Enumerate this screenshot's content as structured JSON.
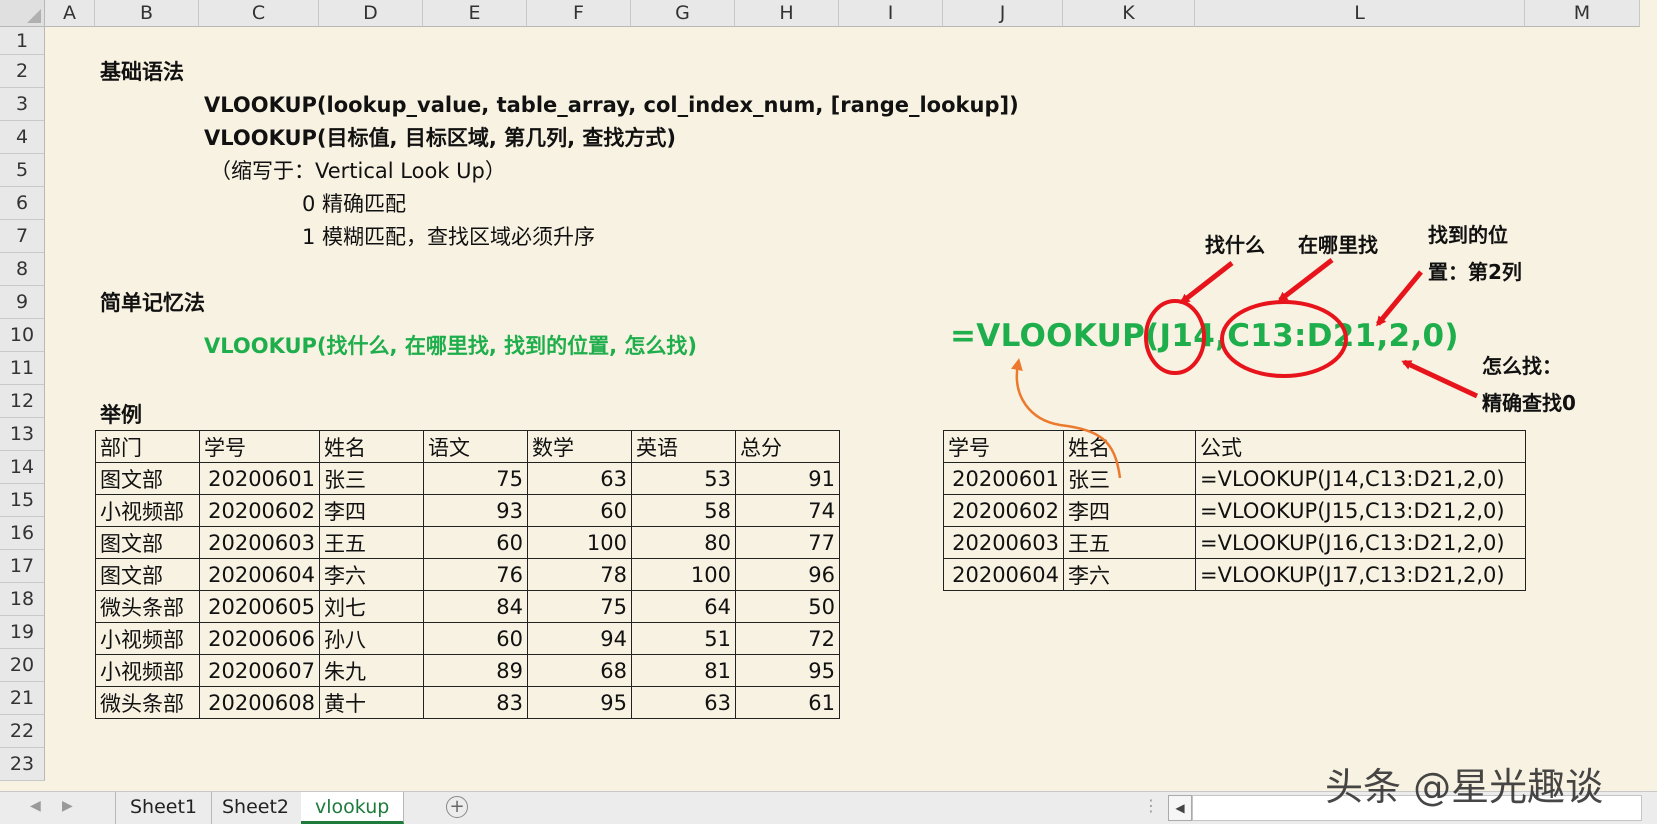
{
  "columns": [
    "A",
    "B",
    "C",
    "D",
    "E",
    "F",
    "G",
    "H",
    "I",
    "J",
    "K",
    "L",
    "M"
  ],
  "rows": [
    "1",
    "2",
    "3",
    "4",
    "5",
    "6",
    "7",
    "8",
    "9",
    "10",
    "11",
    "12",
    "13",
    "14",
    "15",
    "16",
    "17",
    "18",
    "19",
    "20",
    "21",
    "22",
    "23"
  ],
  "syntax": {
    "heading": "基础语法",
    "line_en": "VLOOKUP(lookup_value, table_array, col_index_num, [range_lookup])",
    "line_cn": "VLOOKUP(目标值, 目标区域, 第几列, 查找方式)",
    "abbrev": "（缩写于：Vertical Look Up）",
    "opt0": "0  精确匹配",
    "opt1": "1  模糊匹配，查找区域必须升序"
  },
  "memory": {
    "heading": "简单记忆法",
    "formula": "VLOOKUP(找什么, 在哪里找, 找到的位置, 怎么找)"
  },
  "example": {
    "heading": "举例",
    "headers": [
      "部门",
      "学号",
      "姓名",
      "语文",
      "数学",
      "英语",
      "总分"
    ],
    "rows": [
      [
        "图文部",
        "20200601",
        "张三",
        "75",
        "63",
        "53",
        "91"
      ],
      [
        "小视频部",
        "20200602",
        "李四",
        "93",
        "60",
        "58",
        "74"
      ],
      [
        "图文部",
        "20200603",
        "王五",
        "60",
        "100",
        "80",
        "77"
      ],
      [
        "图文部",
        "20200604",
        "李六",
        "76",
        "78",
        "100",
        "96"
      ],
      [
        "微头条部",
        "20200605",
        "刘七",
        "84",
        "75",
        "64",
        "50"
      ],
      [
        "小视频部",
        "20200606",
        "孙八",
        "60",
        "94",
        "51",
        "72"
      ],
      [
        "小视频部",
        "20200607",
        "朱九",
        "89",
        "68",
        "81",
        "95"
      ],
      [
        "微头条部",
        "20200608",
        "黄十",
        "83",
        "95",
        "63",
        "61"
      ]
    ]
  },
  "lookup_table": {
    "headers": [
      "学号",
      "姓名",
      "公式"
    ],
    "rows": [
      [
        "20200601",
        "张三",
        "=VLOOKUP(J14,C13:D21,2,0)"
      ],
      [
        "20200602",
        "李四",
        "=VLOOKUP(J15,C13:D21,2,0)"
      ],
      [
        "20200603",
        "王五",
        "=VLOOKUP(J16,C13:D21,2,0)"
      ],
      [
        "20200604",
        "李六",
        "=VLOOKUP(J17,C13:D21,2,0)"
      ]
    ]
  },
  "big_formula": "=VLOOKUP(J14,C13:D21,2,0)",
  "annotations": {
    "what": "找什么",
    "where": "在哪里找",
    "position_1": "找到的位",
    "position_2": "置：第2列",
    "how_1": "怎么找：",
    "how_2": "精确查找0"
  },
  "colors": {
    "green": "#1fae4c",
    "red": "#e8141c",
    "orange": "#ec7a2e",
    "tab_active": "#1e7b3c"
  },
  "tabs": [
    "Sheet1",
    "Sheet2",
    "vlookup"
  ],
  "active_tab": "vlookup",
  "icons": [
    "prev-sheet-icon",
    "next-sheet-icon",
    "add-sheet-icon",
    "scroll-left-icon"
  ],
  "watermark": "头条 @星光趣谈"
}
